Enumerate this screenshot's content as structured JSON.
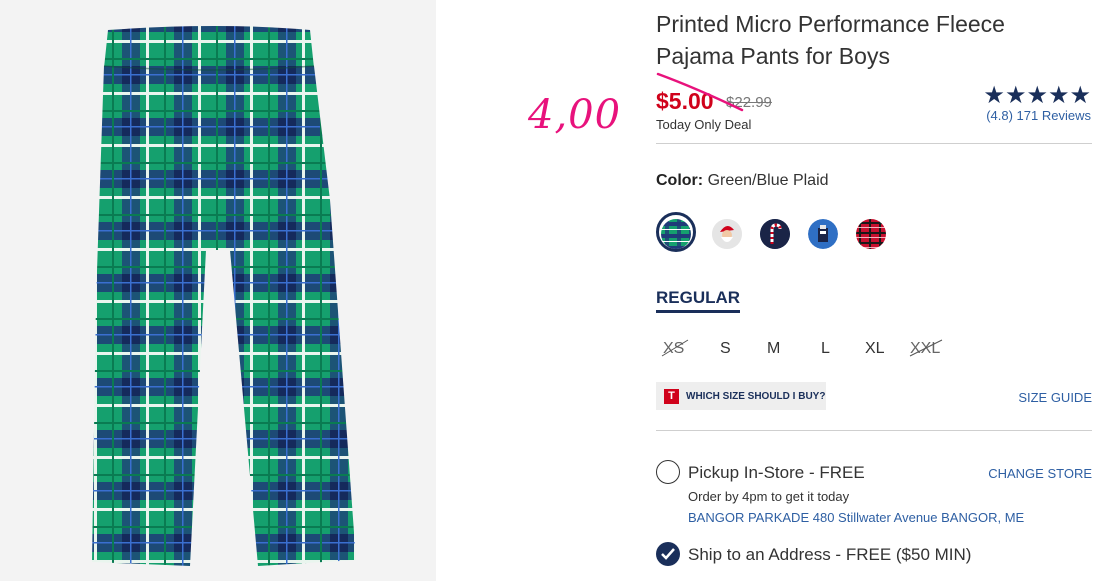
{
  "product": {
    "title_line1": "Printed Micro Performance Fleece",
    "title_line2": "Pajama Pants for Boys",
    "sale_price": "$5.00",
    "original_price": "$22.99",
    "deal_text": "Today Only Deal",
    "annotation": "4,00"
  },
  "rating": {
    "stars": "★★★★★",
    "text": "(4.8) 171 Reviews",
    "value": 4.8
  },
  "color": {
    "label": "Color:",
    "value": "Green/Blue Plaid",
    "swatches": [
      "green-blue-plaid",
      "santa",
      "candy-cane",
      "nutcracker",
      "red-plaid"
    ]
  },
  "fit_tab": "REGULAR",
  "sizes": [
    {
      "label": "XS",
      "available": false
    },
    {
      "label": "S",
      "available": true
    },
    {
      "label": "M",
      "available": true
    },
    {
      "label": "L",
      "available": true
    },
    {
      "label": "XL",
      "available": true
    },
    {
      "label": "XXL",
      "available": false
    }
  ],
  "fit_help": {
    "icon": "T",
    "text": "WHICH SIZE SHOULD I BUY?",
    "size_guide": "SIZE GUIDE"
  },
  "pickup": {
    "label": "Pickup In-Store - FREE",
    "change_store": "CHANGE STORE",
    "sub": "Order by 4pm to get it today",
    "address": "BANGOR PARKADE 480 Stillwater Avenue  BANGOR, ME"
  },
  "ship": {
    "label": "Ship to an Address - FREE ($50 MIN)"
  },
  "colors": {
    "navy": "#1a2f5a",
    "sale_red": "#d0021b",
    "link_blue": "#2e5fa3",
    "annotation_pink": "#e8127c"
  }
}
